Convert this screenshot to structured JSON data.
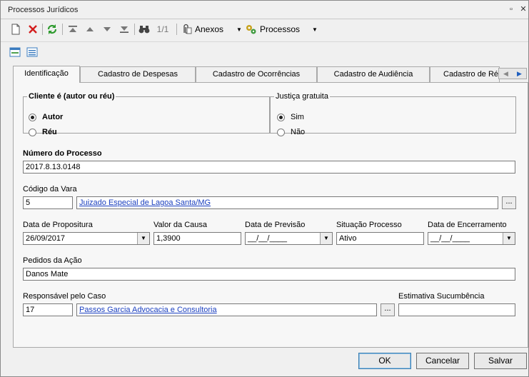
{
  "window": {
    "title": "Processos Jurídicos"
  },
  "toolbar": {
    "page_indicator": "1/1",
    "anexos_label": "Anexos",
    "processos_label": "Processos"
  },
  "tabs": [
    {
      "label": "Identificação"
    },
    {
      "label": "Cadastro de Despesas"
    },
    {
      "label": "Cadastro de Ocorrências"
    },
    {
      "label": "Cadastro de Audiência"
    },
    {
      "label": "Cadastro de Ré"
    }
  ],
  "cliente_group": {
    "title": "Cliente é (autor ou réu)",
    "options": [
      {
        "label": "Autor",
        "selected": true
      },
      {
        "label": "Réu",
        "selected": false
      }
    ]
  },
  "justica_group": {
    "title": "Justiça gratuita",
    "options": [
      {
        "label": "Sim",
        "selected": true
      },
      {
        "label": "Não",
        "selected": false
      }
    ]
  },
  "fields": {
    "numero_processo": {
      "label": "Número do Processo",
      "value": "2017.8.13.0148"
    },
    "codigo_vara": {
      "label": "Código da Vara",
      "code": "5",
      "name": "Juizado Especial de Lagoa Santa/MG"
    },
    "data_propositura": {
      "label": "Data de Propositura",
      "value": "26/09/2017"
    },
    "valor_causa": {
      "label": "Valor da Causa",
      "value": "1,3900"
    },
    "data_previsao": {
      "label": "Data de Previsão",
      "value": "__/__/____"
    },
    "situacao_processo": {
      "label": "Situação Processo",
      "value": "Ativo"
    },
    "data_encerramento": {
      "label": "Data de Encerramento",
      "value": "__/__/____"
    },
    "pedidos_acao": {
      "label": "Pedidos da Ação",
      "value": "Danos Mate"
    },
    "responsavel": {
      "label": "Responsável pelo Caso",
      "code": "17",
      "name": "Passos Garcia Advocacia e Consultoria"
    },
    "estimativa": {
      "label": "Estimativa Sucumbência",
      "value": ""
    }
  },
  "buttons": {
    "ok": "OK",
    "cancelar": "Cancelar",
    "salvar": "Salvar"
  }
}
